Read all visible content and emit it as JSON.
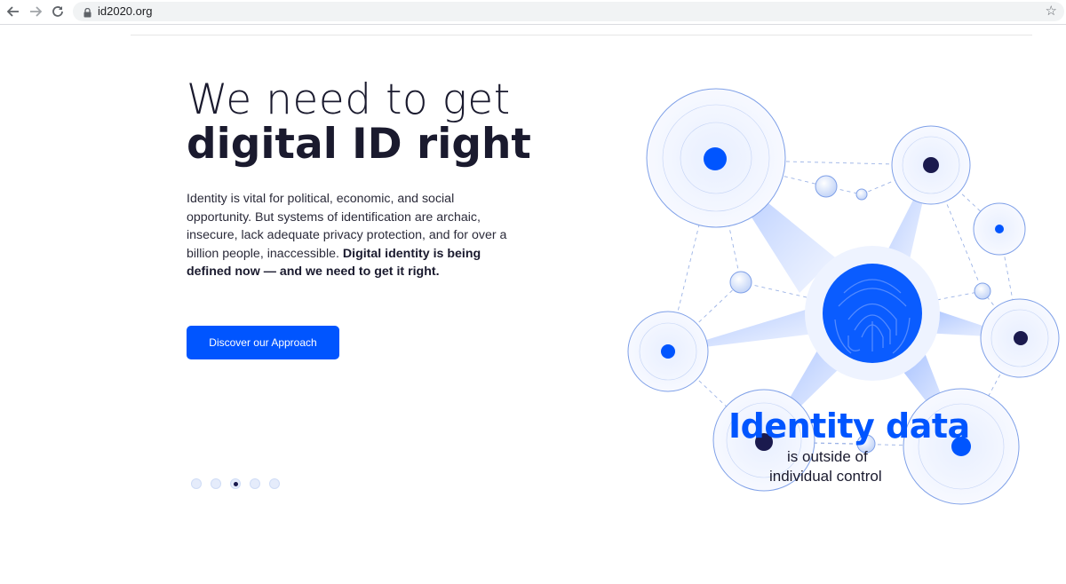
{
  "browser": {
    "url": "id2020.org",
    "icons": [
      "back-arrow-icon",
      "forward-arrow-icon",
      "reload-icon",
      "lock-icon",
      "star-icon"
    ]
  },
  "hero": {
    "title_line1": "We need to get",
    "title_line2": "digital ID right",
    "paragraph_regular": "Identity is vital for political, economic, and social opportunity. But systems of identification are archaic, insecure, lack adequate privacy protection, and for over a billion people, inaccessible.",
    "paragraph_bold": "Digital identity is being defined now — and we need to get it right.",
    "cta_label": "Discover our Approach"
  },
  "carousel": {
    "slide_count": 5,
    "active_index": 2
  },
  "illustration": {
    "headline": "Identity data",
    "sub_line1": "is outside of",
    "sub_line2": "individual control",
    "icon": "fingerprint-icon"
  },
  "colors": {
    "accent": "#0055ff",
    "dark": "#1a1a4e",
    "text": "#1a1a2e"
  }
}
